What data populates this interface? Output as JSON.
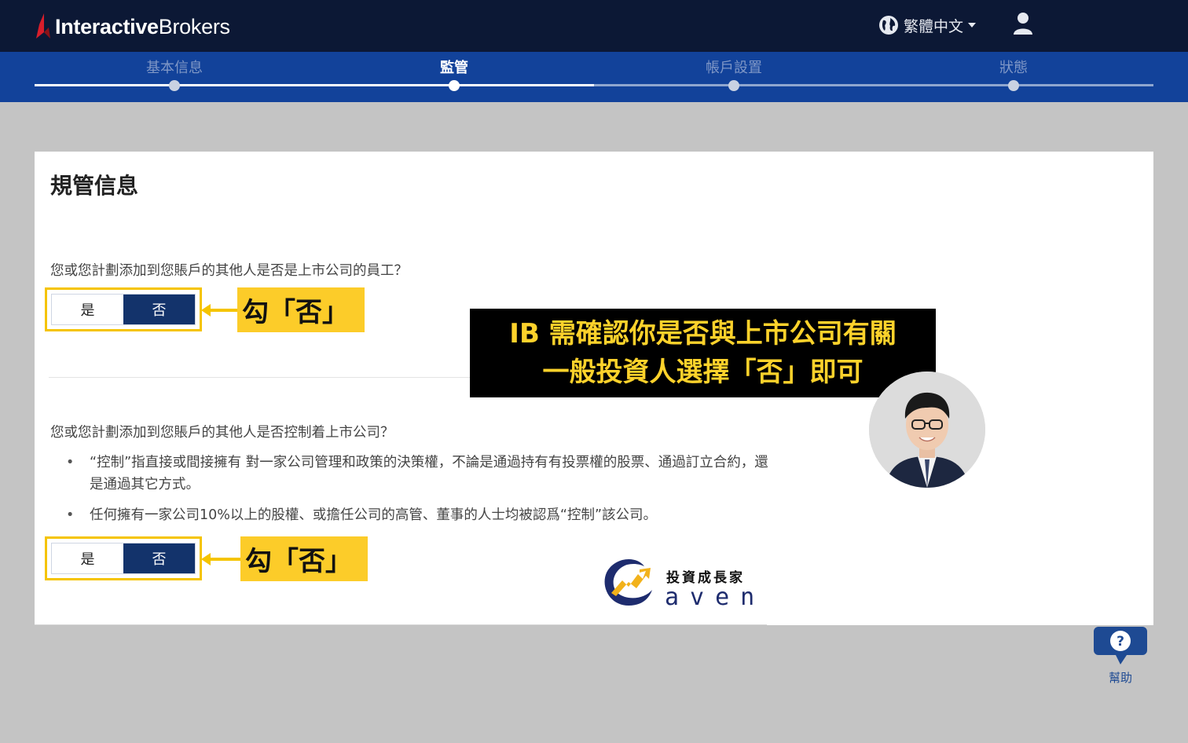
{
  "header": {
    "logo_text_bold": "Interactive",
    "logo_text_light": "Brokers",
    "language": "繁體中文",
    "colors": {
      "bar": "#0c1835",
      "logo_accent": "#d81e2b"
    }
  },
  "stepper": {
    "steps": [
      {
        "label": "基本信息"
      },
      {
        "label": "監管"
      },
      {
        "label": "帳戶設置"
      },
      {
        "label": "狀態"
      }
    ],
    "active_step": "監管",
    "colors": {
      "bar": "#12429a"
    }
  },
  "form": {
    "title": "規管信息",
    "question_1": "您或您計劃添加到您賬戶的其他人是否是上市公司的員工？",
    "question_2": "您或您計劃添加到您賬戶的其他人是否控制着上市公司？",
    "bullets": [
      "“控制”指直接或間接擁有 對一家公司管理和政策的決策權，不論是通過持有有投票權的股票、通過訂立合約，還是通過其它方式。",
      "任何擁有一家公司10%以上的股權、或擔任公司的高管、董事的人士均被認爲“控制”該公司。"
    ],
    "toggle_1": {
      "yes": "是",
      "no": "否",
      "selected": "否"
    },
    "toggle_2": {
      "yes": "是",
      "no": "否",
      "selected": "否"
    }
  },
  "annotations": {
    "callout_1": "勾「否」",
    "callout_2": "勾「否」",
    "banner_line_1": "IB 需確認你是否與上市公司有關",
    "banner_line_2": "一般投資人選擇「否」即可",
    "colors": {
      "highlight": "#fccc29",
      "banner_text": "#fdd22b"
    }
  },
  "brand": {
    "name": "投資成長家",
    "word": "aven"
  },
  "help": {
    "label": "幫助",
    "icon": "question-bubble-icon"
  }
}
